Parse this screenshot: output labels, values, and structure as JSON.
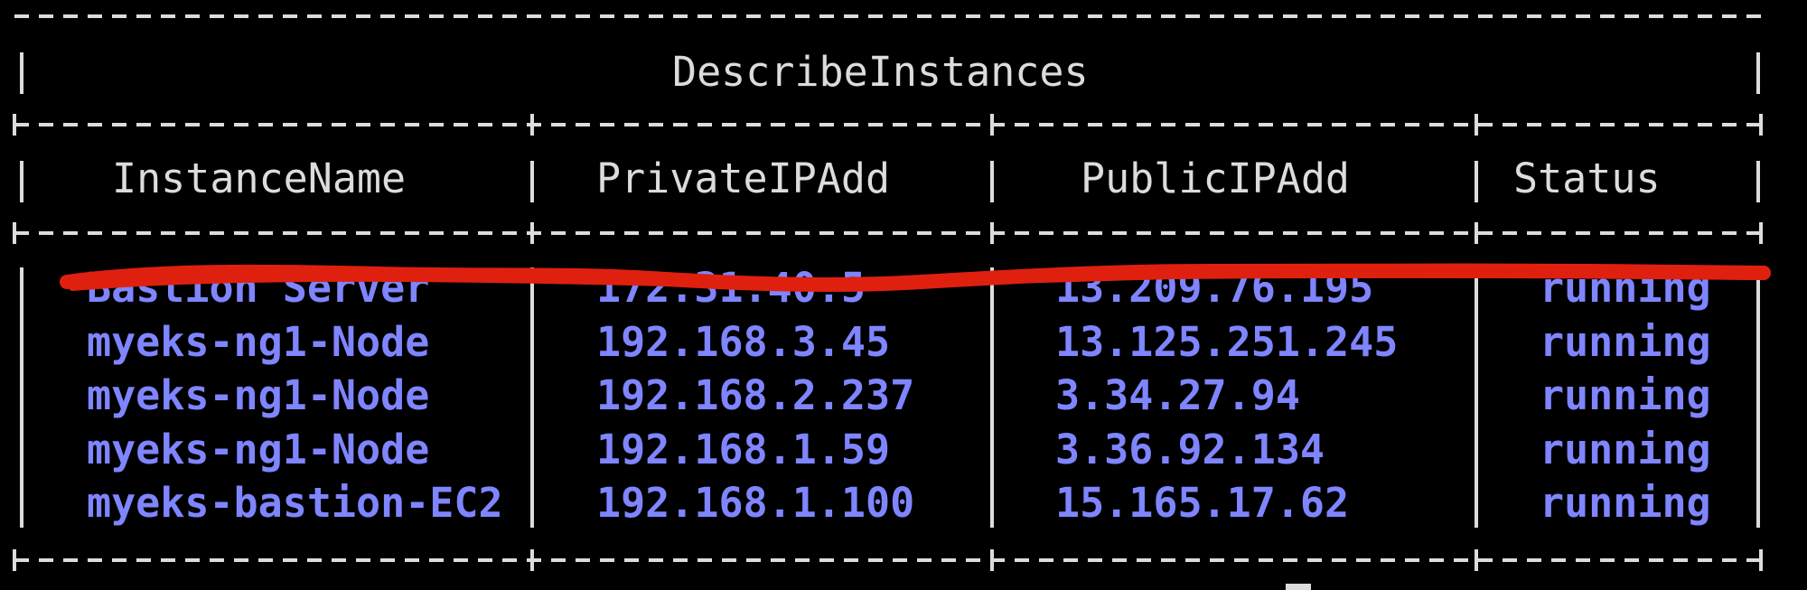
{
  "table": {
    "title": "DescribeInstances",
    "headers": [
      "InstanceName",
      "PrivateIPAdd",
      "PublicIPAdd",
      "Status"
    ],
    "rows": [
      [
        "Bastion Server",
        "172.31.40.5",
        "13.209.76.195",
        "running"
      ],
      [
        "myeks-ng1-Node",
        "192.168.3.45",
        "13.125.251.245",
        "running"
      ],
      [
        "myeks-ng1-Node",
        "192.168.2.237",
        "3.34.27.94",
        "running"
      ],
      [
        "myeks-ng1-Node",
        "192.168.1.59",
        "3.36.92.134",
        "running"
      ],
      [
        "myeks-bastion-EC2",
        "192.168.1.100",
        "15.165.17.62",
        "running"
      ]
    ]
  },
  "colors": {
    "background": "#000000",
    "border": "#dcdcdc",
    "header_text": "#dcdcdc",
    "cell_text": "#7f85ff",
    "redaction": "#e0200f"
  }
}
